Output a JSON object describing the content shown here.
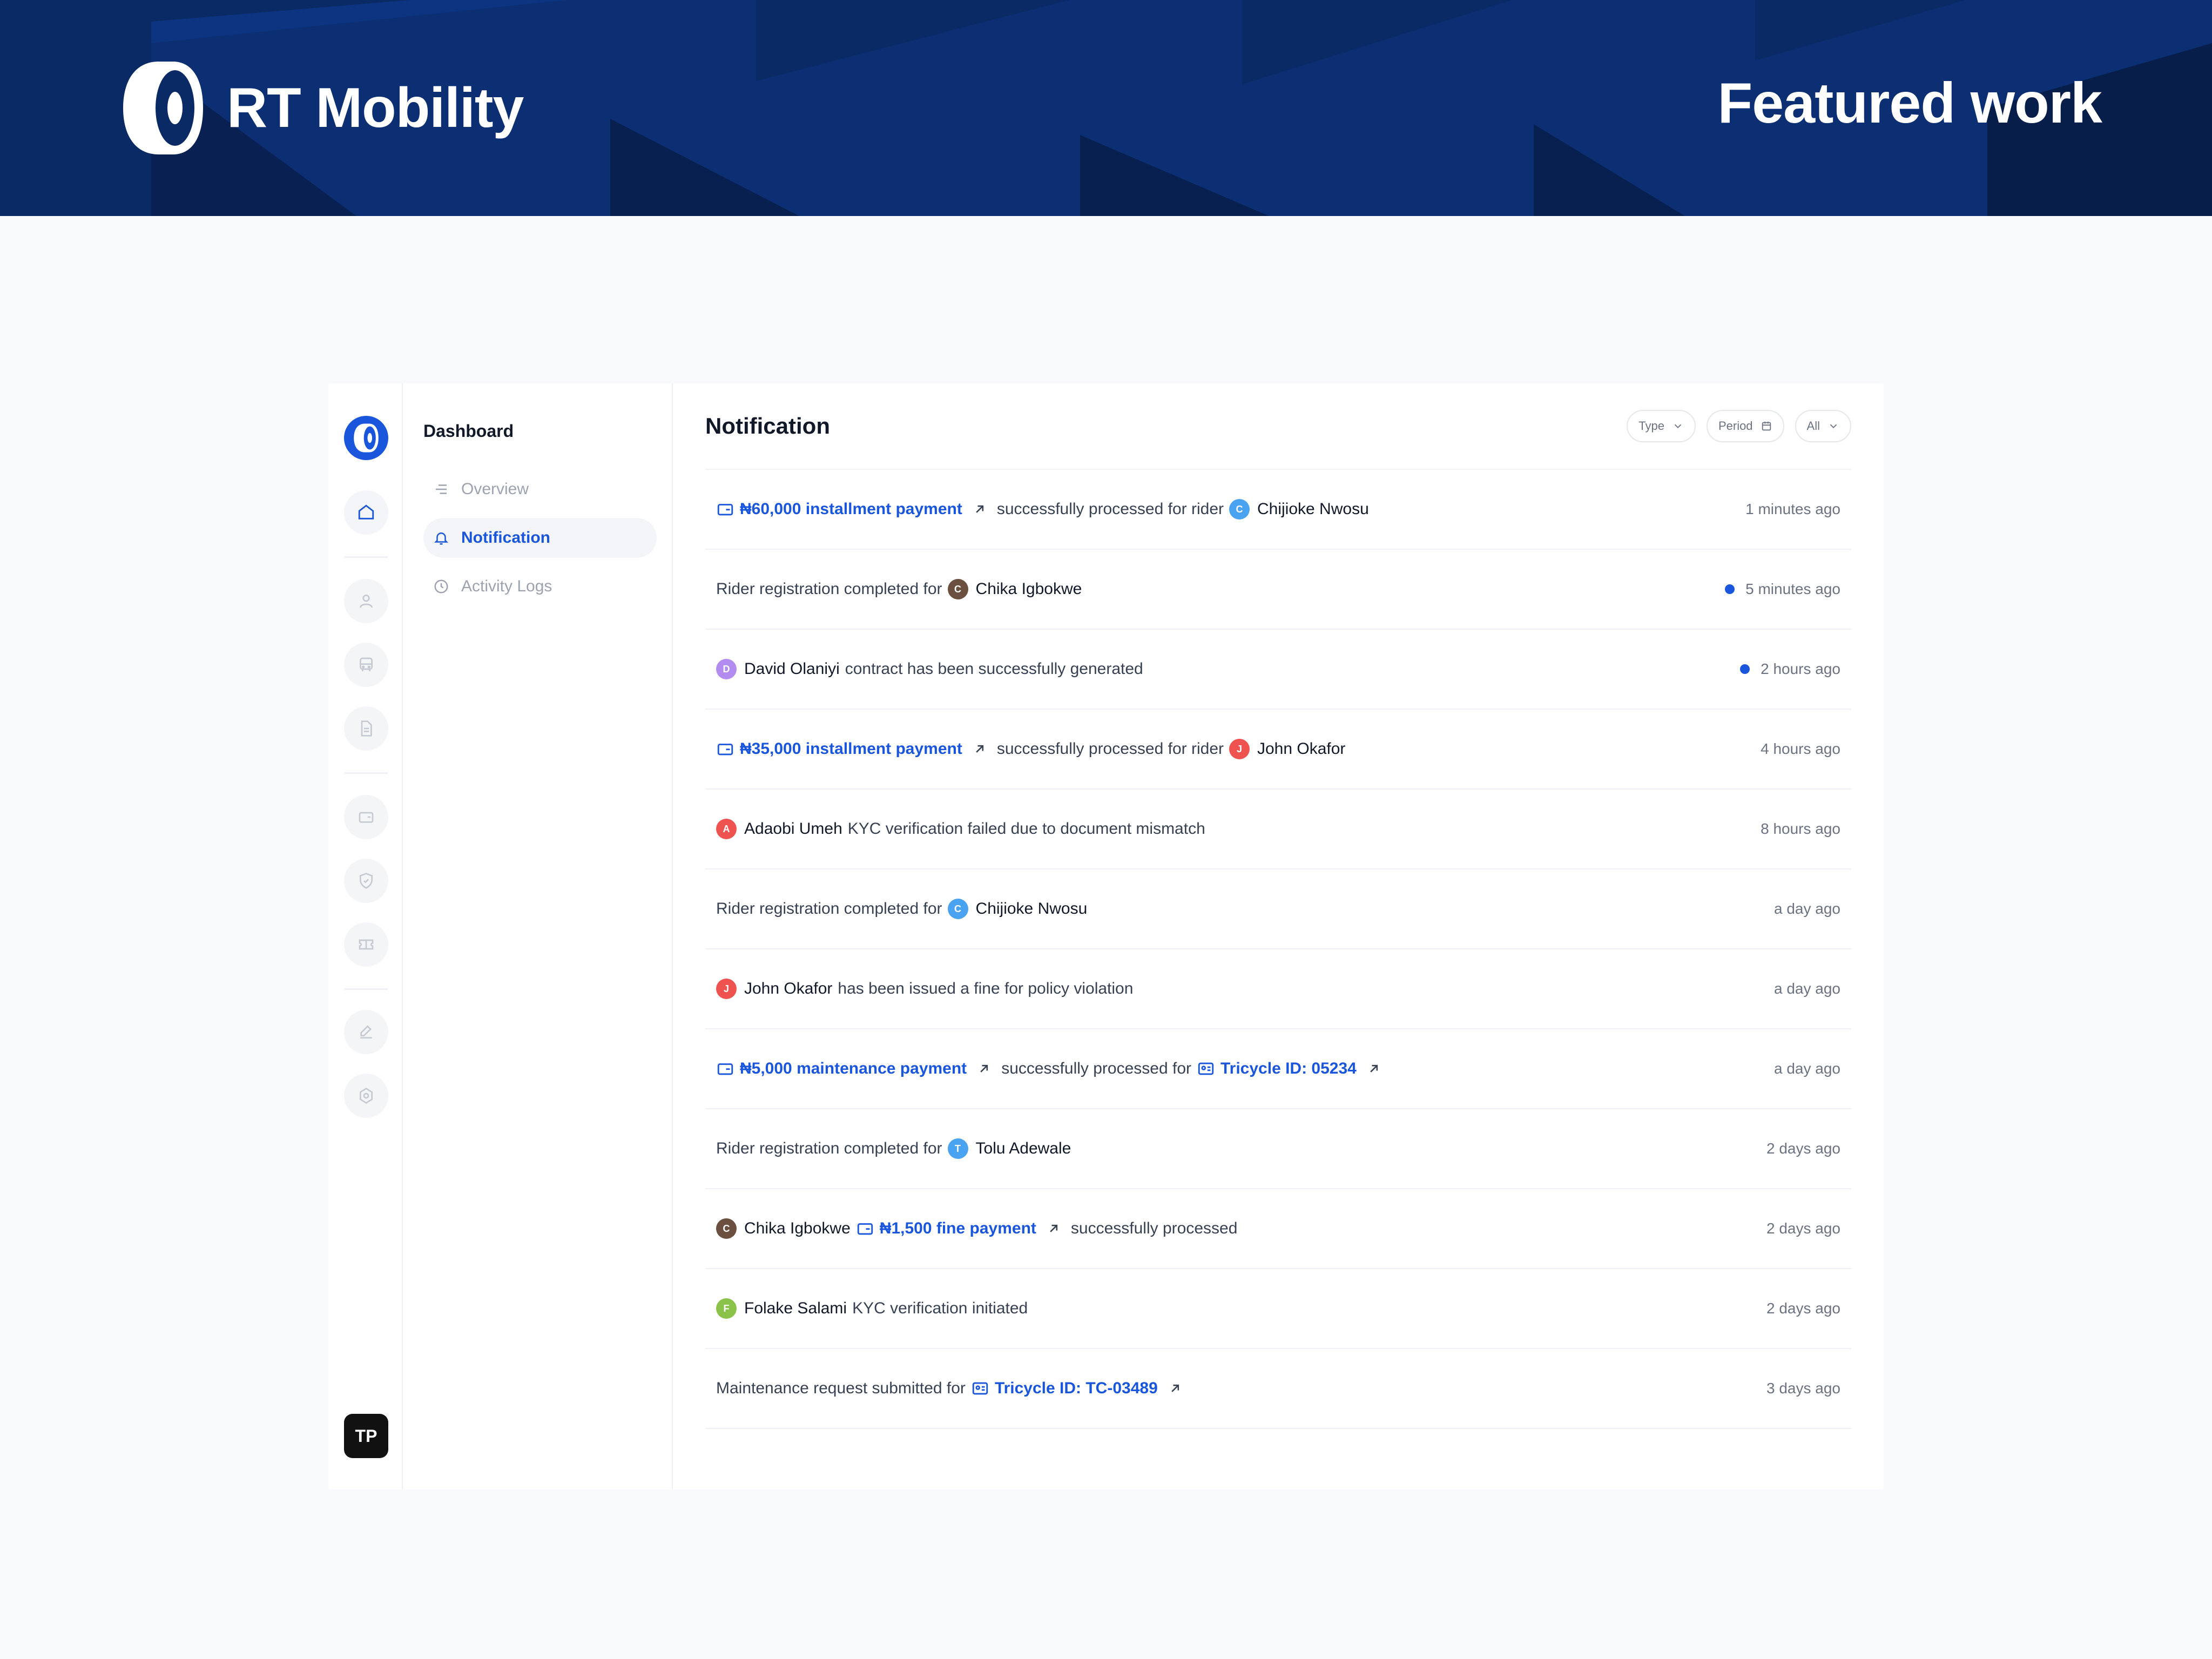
{
  "hero": {
    "brand_name": "RT Mobility",
    "tagline": "Featured work"
  },
  "sidebar": {
    "icons": [
      "home-icon",
      "user-icon",
      "bus-icon",
      "document-icon",
      "wallet-icon",
      "shield-icon",
      "ticket-icon",
      "edit-icon",
      "settings-icon"
    ],
    "user_initials": "TP"
  },
  "subnav": {
    "title": "Dashboard",
    "items": [
      {
        "label": "Overview",
        "icon": "list-icon",
        "active": false
      },
      {
        "label": "Notification",
        "icon": "bell-icon",
        "active": true
      },
      {
        "label": "Activity Logs",
        "icon": "clock-icon",
        "active": false
      }
    ]
  },
  "main": {
    "title": "Notification",
    "filters": {
      "type_label": "Type",
      "period_label": "Period",
      "all_label": "All"
    }
  },
  "notifications": [
    {
      "payment": "₦60,000 installment payment",
      "text": "successfully processed for rider",
      "person": "Chijioke Nwosu",
      "initial": "C",
      "time": "1 minutes ago",
      "unread": false
    },
    {
      "text": "Rider registration completed for",
      "person": "Chika Igbokwe",
      "initial": "C",
      "time": "5 minutes ago",
      "unread": true
    },
    {
      "person": "David Olaniyi",
      "initial": "D",
      "text": "contract has been successfully generated",
      "time": "2 hours ago",
      "unread": true
    },
    {
      "payment": "₦35,000 installment payment",
      "text": "successfully processed for rider",
      "person": "John Okafor",
      "initial": "J",
      "time": "4 hours ago",
      "unread": false
    },
    {
      "person": "Adaobi Umeh",
      "initial": "A",
      "text": "KYC verification failed due to document mismatch",
      "time": "8 hours ago",
      "unread": false
    },
    {
      "text": "Rider registration completed for",
      "person": "Chijioke Nwosu",
      "initial": "C",
      "time": "a day ago",
      "unread": false
    },
    {
      "person": "John Okafor",
      "initial": "J",
      "text": "has been issued a fine for policy violation",
      "time": "a day ago",
      "unread": false
    },
    {
      "payment": "₦5,000 maintenance payment",
      "text": "successfully processed for",
      "vehicle": "Tricycle ID: 05234",
      "time": "a day ago",
      "unread": false
    },
    {
      "text": "Rider registration completed for",
      "person": "Tolu Adewale",
      "initial": "T",
      "time": "2 days ago",
      "unread": false
    },
    {
      "person": "Chika Igbokwe",
      "initial": "C",
      "payment": "₦1,500 fine payment",
      "text": "successfully processed",
      "time": "2 days ago",
      "unread": false
    },
    {
      "person": "Folake Salami",
      "initial": "F",
      "text": "KYC verification initiated",
      "time": "2 days ago",
      "unread": false
    },
    {
      "text": "Maintenance request submitted for",
      "vehicle": "Tricycle ID: TC-03489",
      "time": "3 days ago",
      "unread": false
    }
  ],
  "colors": {
    "brand_navy": "#0a2a66",
    "accent_blue": "#1a56db",
    "avatar_blue": "#4aa3f0",
    "avatar_brown": "#6b4f3f",
    "avatar_purple": "#b38cf0",
    "avatar_red": "#ef5350",
    "avatar_green": "#8bc34a"
  }
}
